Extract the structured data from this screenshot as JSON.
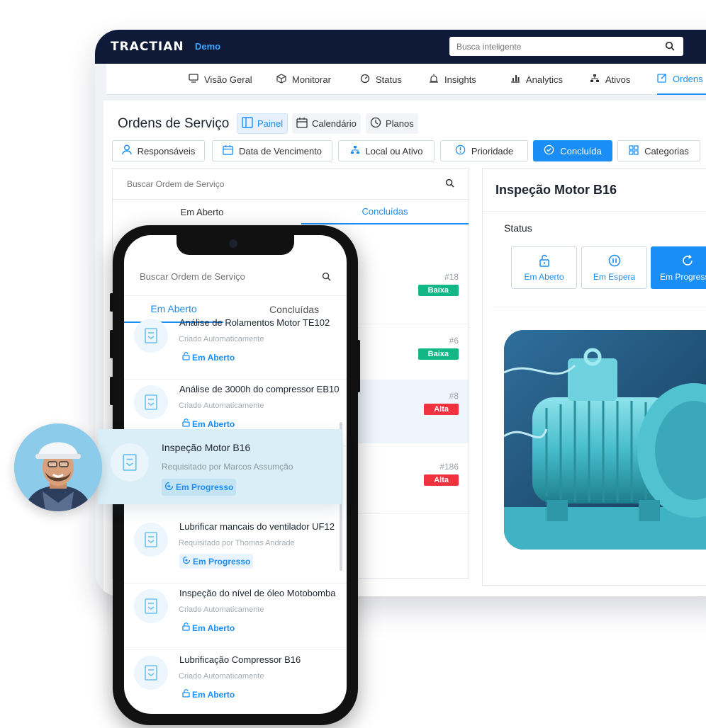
{
  "app": {
    "brand": "TRACTIAN",
    "env": "Demo",
    "search_placeholder": "Busca inteligente"
  },
  "nav": [
    {
      "label": "Visão Geral",
      "icon": "monitor-icon"
    },
    {
      "label": "Monitorar",
      "icon": "cube-icon"
    },
    {
      "label": "Status",
      "icon": "gauge-icon"
    },
    {
      "label": "Insights",
      "icon": "alarm-icon"
    },
    {
      "label": "Analytics",
      "icon": "bar-chart-icon"
    },
    {
      "label": "Ativos",
      "icon": "hierarchy-icon"
    },
    {
      "label": "Ordens",
      "icon": "edit-icon",
      "active": true
    }
  ],
  "page": {
    "title": "Ordens de Serviço",
    "views": [
      "Painel",
      "Calendário",
      "Planos"
    ],
    "filters": [
      "Responsáveis",
      "Data de Vencimento",
      "Local ou Ativo",
      "Prioridade",
      "Concluída",
      "Categorias"
    ]
  },
  "list": {
    "search_placeholder": "Buscar Ordem de Serviço",
    "tabs": [
      "Em Aberto",
      "Concluídas"
    ],
    "rows": [
      {
        "num": "#18",
        "priority": "Baixa"
      },
      {
        "num": "#6",
        "priority": "Baixa"
      },
      {
        "num": "#8",
        "priority": "Alta"
      },
      {
        "num": "#186",
        "priority": "Alta"
      }
    ]
  },
  "detail": {
    "title": "Inspeção Motor B16",
    "status_label": "Status",
    "status_buttons": [
      "Em Aberto",
      "Em Espera",
      "Em Progresso"
    ]
  },
  "phone": {
    "search_placeholder": "Buscar Ordem de Serviço",
    "tabs": [
      "Em Aberto",
      "Concluídas"
    ],
    "items": [
      {
        "title": "Análise de Rolamentos Motor TE102",
        "sub": "Criado Automaticamente",
        "status": "Em Aberto"
      },
      {
        "title": "Análise de 3000h do compressor EB10",
        "sub": "Criado Automaticamente",
        "status": "Em Aberto"
      },
      {
        "title": "Lubrificar mancais do ventilador UF12",
        "sub": "Requisitado por Thomas Andrade",
        "status": "Em Progresso"
      },
      {
        "title": "Inspeção do nível de óleo Motobomba",
        "sub": "Criado Automaticamente",
        "status": "Em Aberto"
      },
      {
        "title": "Lubrificação Compressor B16",
        "sub": "Criado Automaticamente",
        "status": "Em Aberto"
      }
    ]
  },
  "floating_card": {
    "title": "Inspeção Motor B16",
    "sub": "Requisitado por Marcos Assumção",
    "status": "Em Progresso"
  },
  "colors": {
    "accent": "#1a8ef5",
    "navy": "#0e1a37",
    "low": "#11b886",
    "high": "#f0313e"
  }
}
